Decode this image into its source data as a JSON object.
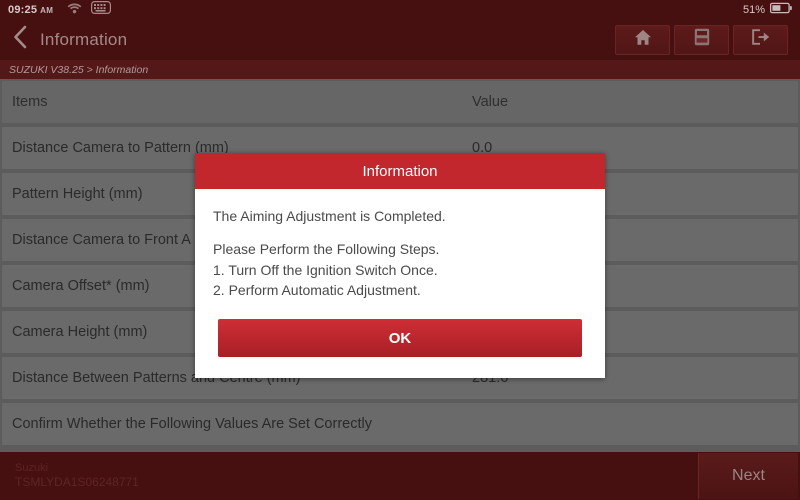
{
  "status_bar": {
    "time": "09:25",
    "ampm": "AM",
    "wifi_icon": "wifi-icon",
    "keyboard_icon": "keyboard-icon",
    "battery_percent": "51%",
    "battery_icon": "battery-icon"
  },
  "title_bar": {
    "back_icon": "back-chevron-icon",
    "title": "Information",
    "buttons": [
      {
        "name": "home-button",
        "icon": "home-icon"
      },
      {
        "name": "report-button",
        "icon": "save-report-icon"
      },
      {
        "name": "exit-button",
        "icon": "exit-icon"
      }
    ]
  },
  "breadcrumb": {
    "text": "SUZUKI V38.25 > Information"
  },
  "table": {
    "columns": [
      "Items",
      "Value"
    ],
    "rows": [
      {
        "item": "Distance Camera to Pattern (mm)",
        "value": "0.0"
      },
      {
        "item": "Pattern Height (mm)",
        "value": ""
      },
      {
        "item": "Distance Camera to Front A",
        "value": ""
      },
      {
        "item": "Camera Offset* (mm)",
        "value": ""
      },
      {
        "item": "Camera Height (mm)",
        "value": ""
      },
      {
        "item": "Distance Between Patterns and Centre (mm)",
        "value": "281.6"
      },
      {
        "item": "Confirm Whether the Following Values Are Set Correctly",
        "value": ""
      }
    ]
  },
  "bottom_bar": {
    "vehicle_make": "Suzuki",
    "vin": "TSMLYDA1S06248771",
    "next_label": "Next"
  },
  "dialog": {
    "title": "Information",
    "line1": "The Aiming Adjustment is Completed.",
    "line2": "Please Perform the Following Steps.",
    "line3": "1. Turn Off the Ignition Switch Once.",
    "line4": "2. Perform Automatic Adjustment.",
    "ok_label": "OK"
  },
  "colors": {
    "header_maroon": "#471010",
    "breadcrumb_maroon": "#541818",
    "dialog_red": "#c1272d",
    "table_gray": "#6a6a6a",
    "table_bg": "#5c5c5c"
  }
}
